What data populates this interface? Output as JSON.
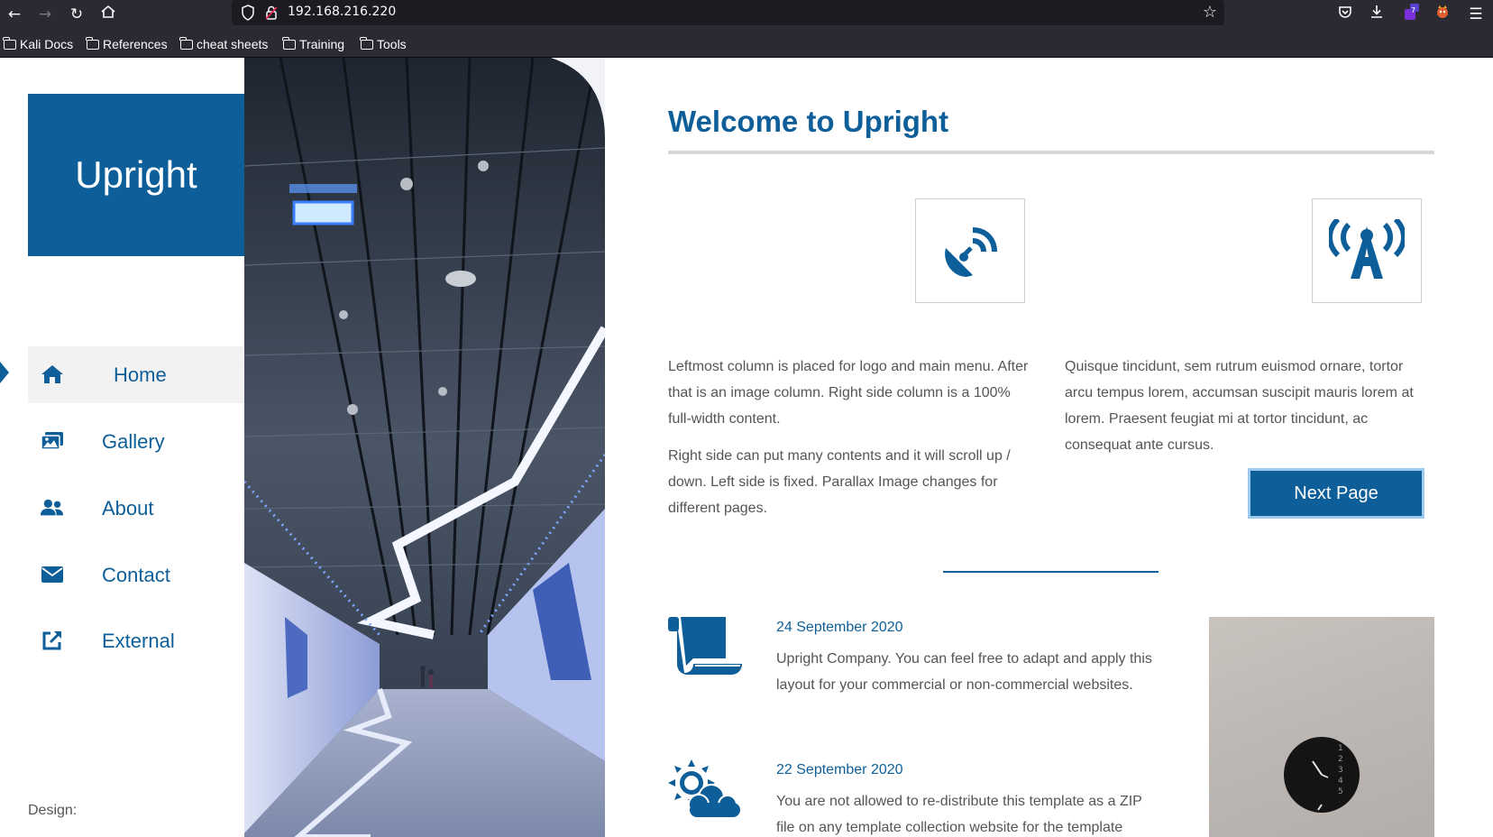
{
  "browser": {
    "url": "192.168.216.220",
    "bookmarks": [
      "Kali Docs",
      "References",
      "cheat sheets",
      "Training",
      "Tools"
    ],
    "extension_badge": "7"
  },
  "site": {
    "logo": "Upright",
    "nav": [
      {
        "label": "Home",
        "icon": "home-icon",
        "active": true
      },
      {
        "label": "Gallery",
        "icon": "images-icon",
        "active": false
      },
      {
        "label": "About",
        "icon": "users-icon",
        "active": false
      },
      {
        "label": "Contact",
        "icon": "envelope-icon",
        "active": false
      },
      {
        "label": "External",
        "icon": "external-link-icon",
        "active": false
      }
    ],
    "design_credit": "Design:"
  },
  "main": {
    "title": "Welcome to Upright",
    "col1_p1": "Leftmost column is placed for logo and main menu. After that is an image column. Right side column is a 100% full-width content.",
    "col1_p2": "Right side can put many contents and it will scroll up / down. Left side is fixed. Parallax Image changes for different pages.",
    "col2_p1": "Quisque tincidunt, sem rutrum euismod ornare, tortor arcu tempus lorem, accumsan suscipit mauris lorem at lorem. Praesent feugiat mi at tortor tincidunt, ac consequat ante cursus.",
    "next_button": "Next Page",
    "news": [
      {
        "date": "24 September 2020",
        "text": "Upright Company. You can feel free to adapt and apply this layout for your commercial or non-commercial websites.",
        "icon": "scroll-icon"
      },
      {
        "date": "22 September 2020",
        "text": "You are not allowed to re-distribute this template as a ZIP file on any template collection website for the template",
        "icon": "sun-cloud-icon"
      }
    ]
  },
  "colors": {
    "brand": "#0e5f99",
    "chrome": "#2b2a33",
    "text": "#555555"
  }
}
